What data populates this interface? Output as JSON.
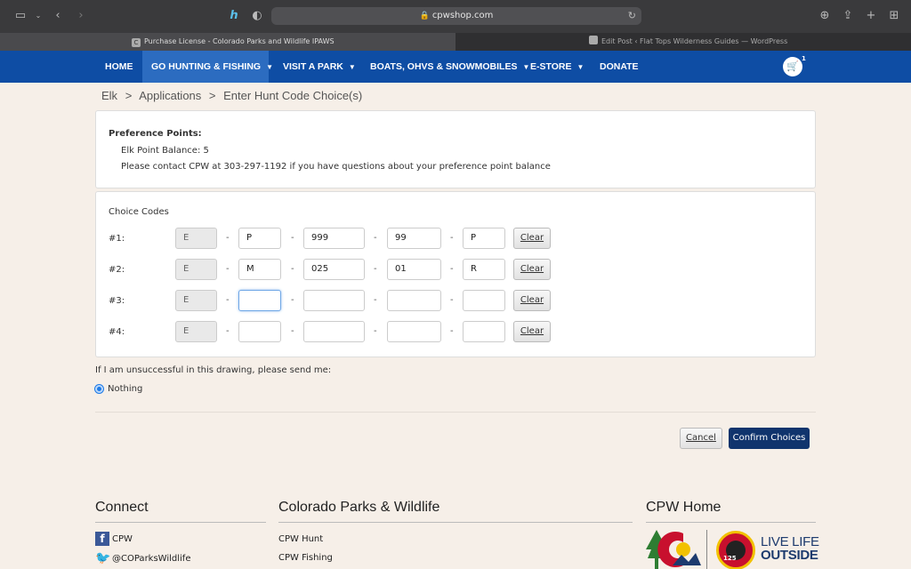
{
  "browser": {
    "address": "cpwshop.com",
    "tabs": [
      {
        "title": "Purchase License - Colorado Parks and Wildlife IPAWS",
        "favicon": "C"
      },
      {
        "title": "Edit Post ‹ Flat Tops Wilderness Guides — WordPress"
      }
    ]
  },
  "nav": {
    "items": [
      "HOME",
      "GO HUNTING & FISHING",
      "VISIT A PARK",
      "BOATS, OHVS & SNOWMOBILES",
      "E-STORE",
      "DONATE"
    ],
    "cart_count": "1"
  },
  "breadcrumb": {
    "items": [
      "Elk",
      ">",
      "Applications",
      ">",
      "Enter Hunt Code Choice(s)"
    ]
  },
  "preference": {
    "title": "Preference Points:",
    "balance": "Elk Point Balance: 5",
    "contact": "Please contact CPW at 303-297-1192 if you have questions about your preference point balance"
  },
  "choices": {
    "title": "Choice Codes",
    "dash": "-",
    "clear_label": "Clear",
    "rows": [
      {
        "label": "#1:",
        "species": "E",
        "sex": "P",
        "unit": "999",
        "season": "99",
        "method": "P"
      },
      {
        "label": "#2:",
        "species": "E",
        "sex": "M",
        "unit": "025",
        "season": "01",
        "method": "R"
      },
      {
        "label": "#3:",
        "species": "E",
        "sex": "",
        "unit": "",
        "season": "",
        "method": ""
      },
      {
        "label": "#4:",
        "species": "E",
        "sex": "",
        "unit": "",
        "season": "",
        "method": ""
      }
    ]
  },
  "unsuccessful": {
    "prompt": "If I am unsuccessful in this drawing, please send me:",
    "option": "Nothing"
  },
  "actions": {
    "cancel": "Cancel",
    "confirm": "Confirm Choices"
  },
  "footer": {
    "connect": {
      "title": "Connect",
      "facebook": "CPW",
      "twitter": "@COParksWildlife"
    },
    "cpw": {
      "title": "Colorado Parks & Wildlife",
      "links": [
        "CPW Hunt",
        "CPW Fishing"
      ]
    },
    "home": {
      "title": "CPW Home",
      "tagline_1": "LIVE LIFE",
      "tagline_2": "OUTSIDE",
      "seal_number": "125"
    }
  },
  "colors": {
    "nav": "#0e4da4",
    "confirm": "#10346d",
    "page_bg": "#f6efe8"
  }
}
